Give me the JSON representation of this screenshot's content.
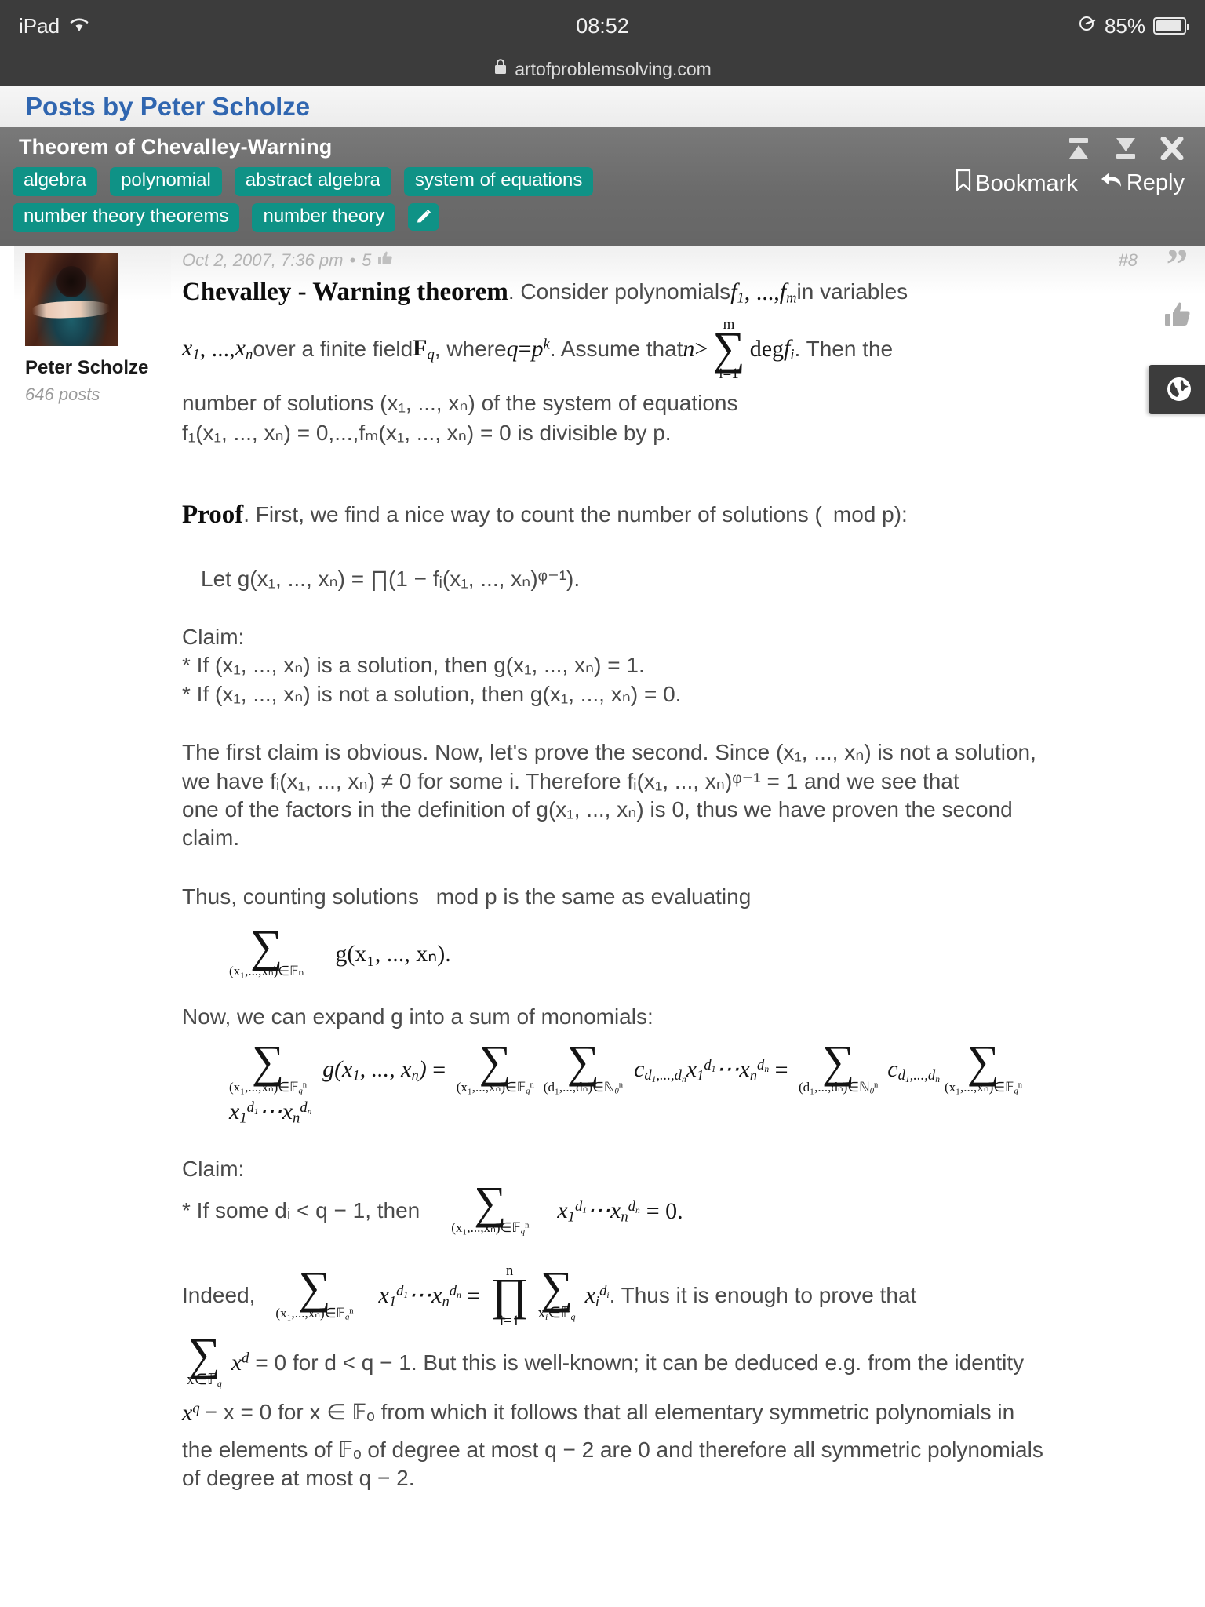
{
  "status_bar": {
    "device": "iPad",
    "wifi_icon": "wifi-icon",
    "time": "08:52",
    "location_icon": "location-icon",
    "battery_percent": "85%",
    "battery_icon": "battery-icon"
  },
  "url_bar": {
    "lock_icon": "lock-icon",
    "domain": "artofproblemsolving.com"
  },
  "page": {
    "title": "Posts by Peter Scholze"
  },
  "topic_header": {
    "title": "Theorem of Chevalley-Warning",
    "icons": [
      {
        "name": "jump-to-top-icon",
        "label": "Jump to top"
      },
      {
        "name": "jump-to-bottom-icon",
        "label": "Jump to bottom"
      },
      {
        "name": "close-icon",
        "label": "Close"
      }
    ],
    "tags_row1": [
      "algebra",
      "polynomial",
      "abstract algebra",
      "system of equations"
    ],
    "tags_row2": [
      "number theory theorems",
      "number theory"
    ],
    "edit_tags_icon": "pencil-icon",
    "bookmark_label": "Bookmark",
    "bookmark_icon": "bookmark-icon",
    "reply_label": "Reply",
    "reply_icon": "reply-arrow-icon",
    "tag_color": "#0f9286",
    "header_bg": "#6b6b6b"
  },
  "post": {
    "author_name": "Peter Scholze",
    "author_posts": "646 posts",
    "avatar_icon": "user-avatar-photo",
    "timestamp": "Oct 2, 2007, 7:36 pm",
    "meta_separator": "•",
    "like_count": "5",
    "like_icon": "thumbs-up-icon",
    "post_number": "#8",
    "quote_icon": "quote-icon",
    "upvote_icon": "thumbs-up-icon",
    "globe_icon": "globe-icon"
  },
  "content": {
    "theorem_name": "Chevalley - Warning theorem",
    "theorem_l1_a": ". Consider polynomials ",
    "theorem_l1_f1": "f",
    "theorem_l1_f1sub": "1",
    "theorem_l1_dots": ", ..., ",
    "theorem_l1_fm": "f",
    "theorem_l1_fmsub": "m",
    "theorem_l1_b": " in variables",
    "theorem_l2_x1": "x",
    "theorem_l2_x1sub": "1",
    "theorem_l2_dots": ", ..., ",
    "theorem_l2_xn": "x",
    "theorem_l2_xnsub": "n",
    "theorem_l2_a": " over a finite field ",
    "theorem_l2_field": "F",
    "theorem_l2_fieldsub": "q",
    "theorem_l2_b": ", where ",
    "theorem_l2_q": "q",
    "theorem_l2_eq": " = ",
    "theorem_l2_p": "p",
    "theorem_l2_psup": "k",
    "theorem_l2_c": ". Assume that ",
    "theorem_l2_n": "n",
    "theorem_l2_gt": " > ",
    "sum_top_m": "m",
    "sum_bottom_i1": "i=1",
    "theorem_l2_deg": "deg ",
    "theorem_l2_fi": "f",
    "theorem_l2_fisub": "i",
    "theorem_l2_d": ". Then the",
    "theorem_l3": "number of solutions (x₁, ..., xₙ) of the system of equations",
    "theorem_l4": "f₁(x₁, ..., xₙ) = 0,...,fₘ(x₁, ..., xₙ) = 0 is divisible by p.",
    "proof_label": "Proof",
    "proof_line": ". First, we find a nice way to count the number of solutions ( mod p):",
    "let_g_prefix": "Let g(x",
    "let_g_line": "Let g(x₁, ..., xₙ) = ∏(1 − fᵢ(x₁, ..., xₙ)ᵠ⁻¹).",
    "claim1_header": "Claim:",
    "claim1_a": "* If (x₁, ..., xₙ) is a solution, then g(x₁, ..., xₙ) = 1.",
    "claim1_b": "* If (x₁, ..., xₙ) is not a solution, then g(x₁, ..., xₙ) = 0.",
    "para1_l1": "The first claim is obvious. Now, let's prove the second. Since (x₁, ..., xₙ) is not a solution,",
    "para1_l2": "we have fᵢ(x₁, ..., xₙ) ≠ 0 for some i. Therefore fᵢ(x₁, ..., xₙ)ᵠ⁻¹ = 1 and we see that",
    "para1_l3": "one of the factors in the definition of g(x₁, ..., xₙ) is 0, thus we have proven the second",
    "para1_l4": "claim.",
    "thus_line": "Thus, counting solutions  mod p is the same as evaluating",
    "sum_g_sub": "(x₁,...,xₙ)∈𝔽ₙ",
    "sum_g_body": "g(x₁, ..., xₙ).",
    "expand_line": "Now, we can expand g into a sum of monomials:",
    "claim2_header": "Claim:",
    "claim2_line": "* If some dᵢ < q − 1, then",
    "claim2_rhs": "= 0.",
    "indeed_label": "Indeed,",
    "indeed_tail": ". Thus it is enough to prove that",
    "final_l1": "= 0 for d < q − 1. But this is well-known; it can be deduced e.g. from the identity",
    "final_l2": "− x = 0 for x ∈ 𝔽ₒ from which it follows that all elementary symmetric polynomials in",
    "final_l3": "the elements of 𝔽ₒ of degree at most q − 2 are 0 and therefore all symmetric polynomials",
    "final_l4": "of degree at most q − 2."
  }
}
